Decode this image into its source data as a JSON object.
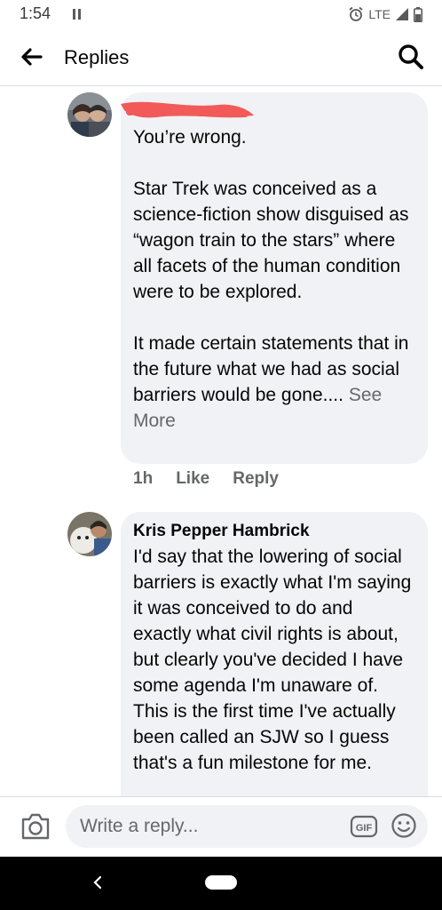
{
  "status_bar": {
    "time": "1:54",
    "network": "LTE"
  },
  "header": {
    "title": "Replies"
  },
  "comments": [
    {
      "author": "",
      "text": "You’re wrong.\n\nStar Trek was conceived as a science-fiction show disguised as “wagon train to the stars” where all facets of the human condition were to be explored.\n\nIt made certain statements that in the future what we had as social barriers would be gone....",
      "see_more": "See More",
      "time": "1h",
      "like_label": "Like",
      "reply_label": "Reply"
    },
    {
      "author": "Kris Pepper Hambrick",
      "text": "I'd say that the lowering of social barriers is exactly what I'm saying it was conceived to do and exactly what civil rights is about, but clearly you've decided I have some agenda I'm unaware of. This is the first time I've actually been called an SJW so I guess that's a fun milestone for me."
    }
  ],
  "reply_bar": {
    "placeholder": "Write a reply...",
    "gif_label": "GIF"
  },
  "colors": {
    "bubble": "#f0f2f5",
    "secondary_text": "#65676b",
    "redaction": "#f25a5a"
  }
}
